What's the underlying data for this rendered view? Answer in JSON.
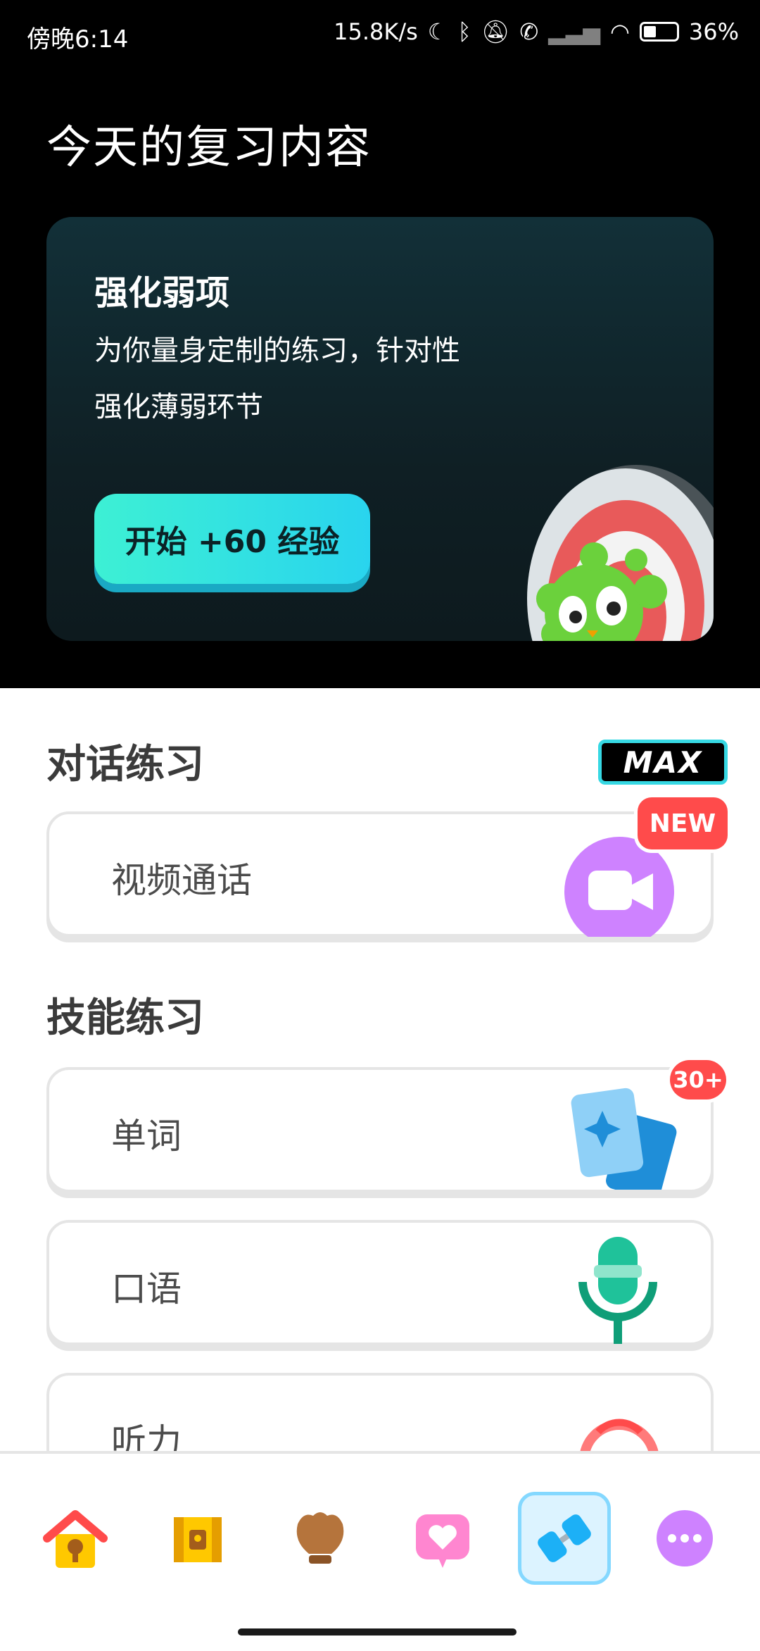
{
  "status": {
    "time": "傍晚6:14",
    "speed": "15.8K/s",
    "battery": "36%"
  },
  "review": {
    "heading": "今天的复习内容",
    "card_title": "强化弱项",
    "card_desc": "为你量身定制的练习，针对性强化薄弱环节",
    "start_button": "开始 +60 经验"
  },
  "conversation": {
    "heading": "对话练习",
    "badge": "MAX",
    "items": [
      {
        "label": "视频通话",
        "badge": "NEW",
        "icon": "video-camera-icon"
      }
    ]
  },
  "skills": {
    "heading": "技能练习",
    "items": [
      {
        "label": "单词",
        "badge": "30+",
        "icon": "flashcards-icon"
      },
      {
        "label": "口语",
        "icon": "microphone-icon"
      },
      {
        "label": "听力",
        "icon": "headphones-icon"
      }
    ]
  },
  "nav": {
    "items": [
      {
        "name": "home",
        "icon": "house-icon"
      },
      {
        "name": "chest",
        "icon": "chest-icon"
      },
      {
        "name": "league",
        "icon": "shield-icon"
      },
      {
        "name": "friends",
        "icon": "heart-bubble-icon"
      },
      {
        "name": "practice",
        "icon": "dumbbell-icon",
        "active": true
      },
      {
        "name": "more",
        "icon": "more-icon"
      }
    ]
  },
  "colors": {
    "accent_cyan": "#3df0d4",
    "badge_red": "#ff4b4b",
    "video_purple": "#ce82ff"
  }
}
